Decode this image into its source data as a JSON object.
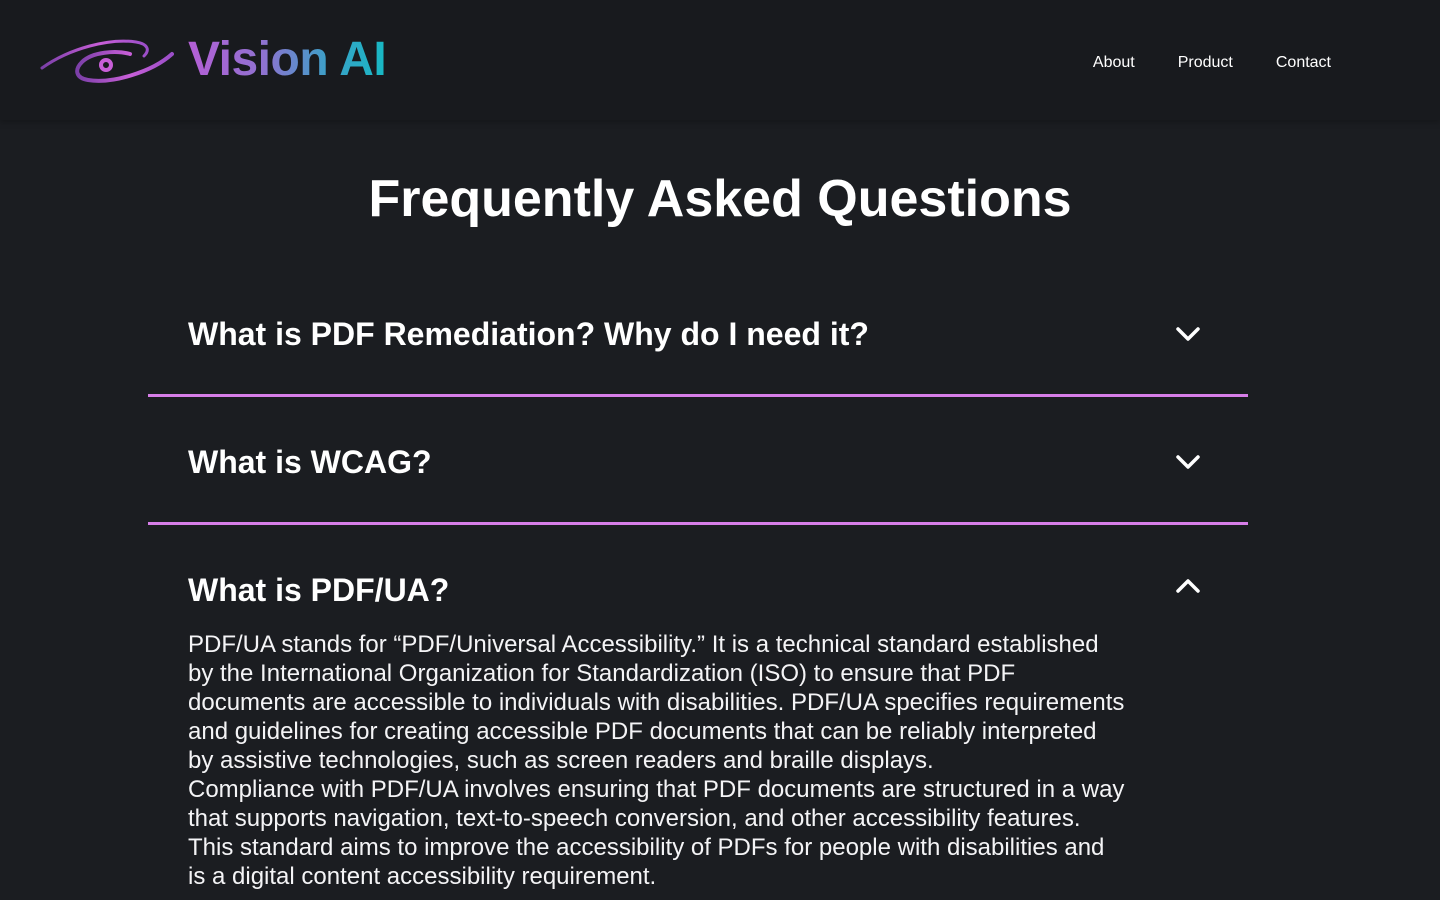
{
  "brand": {
    "name": "Vision AI",
    "gradient": [
      "#b55fd6",
      "#17b9c4"
    ]
  },
  "nav": {
    "items": [
      "About",
      "Product",
      "Contact"
    ]
  },
  "faq": {
    "title": "Frequently Asked Questions",
    "accent_color": "#d77ee8",
    "items": [
      {
        "question": "What is PDF Remediation? Why do I need it?",
        "expanded": false,
        "icon": "chevron-down-icon"
      },
      {
        "question": "What is WCAG?",
        "expanded": false,
        "icon": "chevron-down-icon"
      },
      {
        "question": "What is PDF/UA?",
        "expanded": true,
        "icon": "chevron-up-icon",
        "answer": [
          "PDF/UA stands for “PDF/Universal Accessibility.” It is a technical standard established by the International Organization for Standardization (ISO) to ensure that PDF documents are accessible to individuals with disabilities. PDF/UA specifies requirements and guidelines for creating accessible PDF documents that can be reliably interpreted by assistive technologies, such as screen readers and braille displays.",
          "Compliance with PDF/UA involves ensuring that PDF documents are structured in a way that supports navigation, text-to-speech conversion, and other accessibility features. This standard aims to improve the accessibility of PDFs for people with disabilities and is a digital content accessibility requirement."
        ]
      }
    ]
  }
}
